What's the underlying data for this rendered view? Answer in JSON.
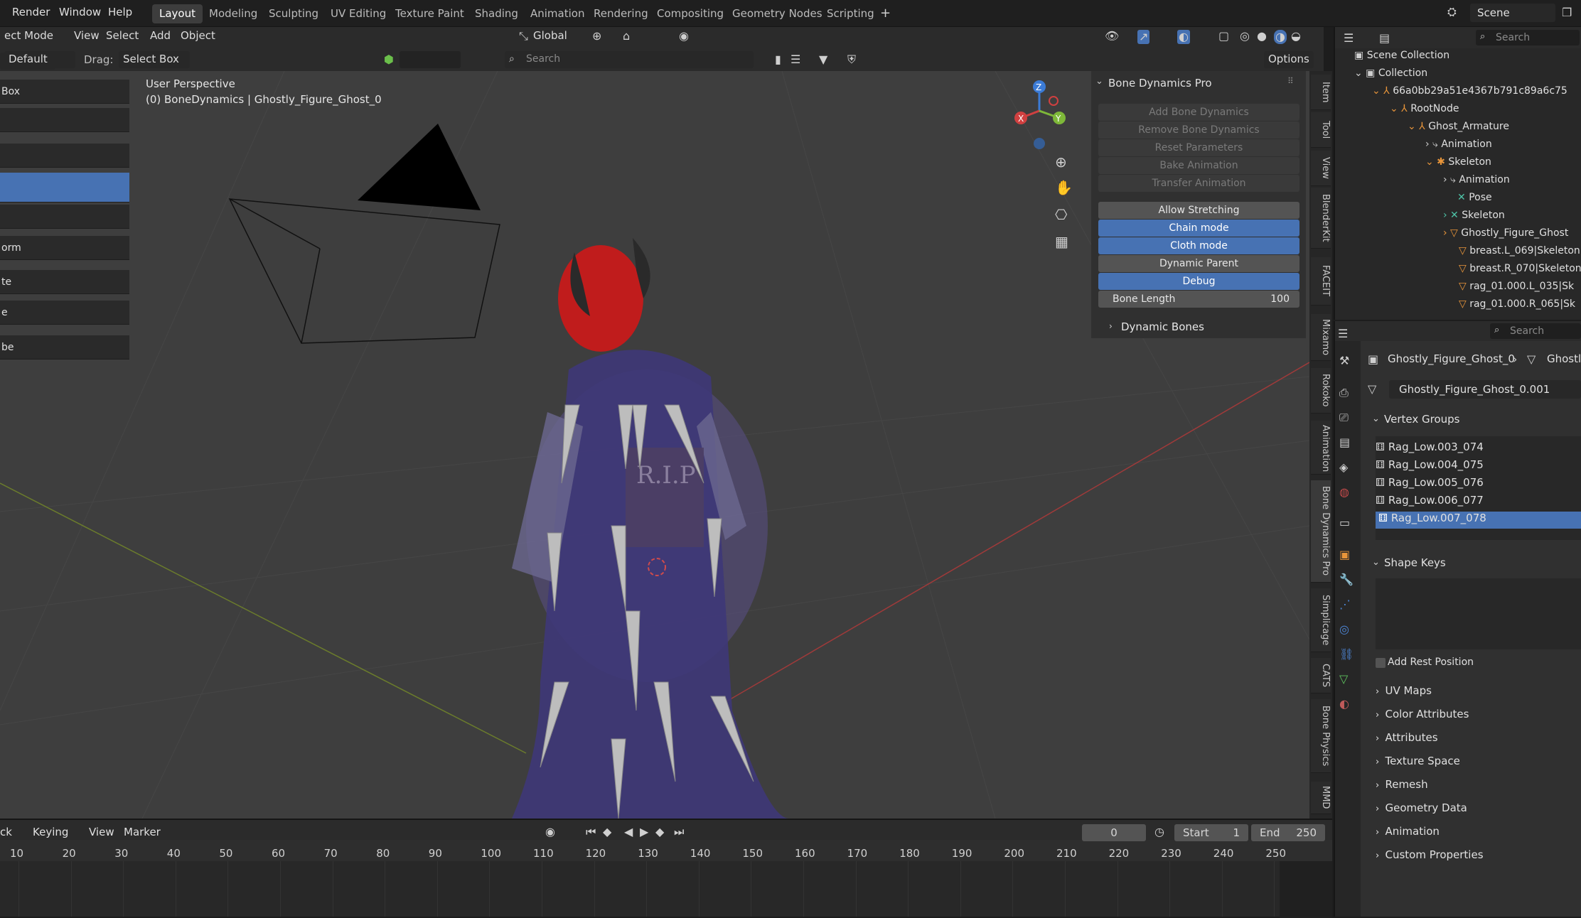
{
  "menus": [
    "Render",
    "Window",
    "Help"
  ],
  "workspaces": [
    "Layout",
    "Modeling",
    "Sculpting",
    "UV Editing",
    "Texture Paint",
    "Shading",
    "Animation",
    "Rendering",
    "Compositing",
    "Geometry Nodes",
    "Scripting"
  ],
  "scene_name": "Scene",
  "header": {
    "mode": "ect Mode",
    "view": "View",
    "select": "Select",
    "add": "Add",
    "object": "Object",
    "transform": "Global",
    "options": "Options"
  },
  "toolbar": {
    "orientation": "Default",
    "drag_label": "Drag:",
    "drag_value": "Select Box",
    "search_placeholder": "Search"
  },
  "viewport": {
    "perspective": "User Perspective",
    "object_info": "(0) BoneDynamics | Ghostly_Figure_Ghost_0"
  },
  "left_panel": [
    "Box",
    "",
    "",
    "",
    "",
    "orm",
    "te",
    "e",
    "be"
  ],
  "npanel": {
    "title": "Bone Dynamics Pro",
    "disabled_buttons": [
      "Add Bone Dynamics",
      "Remove Bone Dynamics",
      "Reset Parameters",
      "Bake Animation",
      "Transfer Animation"
    ],
    "toggles": [
      {
        "label": "Allow Stretching",
        "on": false
      },
      {
        "label": "Chain mode",
        "on": true
      },
      {
        "label": "Cloth mode",
        "on": true
      },
      {
        "label": "Dynamic Parent",
        "on": false
      },
      {
        "label": "Debug",
        "on": true
      }
    ],
    "bone_length_label": "Bone Length",
    "bone_length_value": "100",
    "sub_panel": "Dynamic Bones"
  },
  "vertical_tabs": [
    "Item",
    "Tool",
    "View",
    "BlenderKit",
    "FACEIT",
    "Mixamo",
    "Rokoko",
    "Animation",
    "Bone Dynamics Pro",
    "Simplicage",
    "CATS",
    "Bone Physics",
    "MMD"
  ],
  "outliner": {
    "search_placeholder": "Search",
    "rows": [
      {
        "label": "Scene Collection",
        "indent": 0
      },
      {
        "label": "Collection",
        "indent": 1
      },
      {
        "label": "66a0bb29a51e4367b791c89a6c75",
        "indent": 2
      },
      {
        "label": "RootNode",
        "indent": 3
      },
      {
        "label": "Ghost_Armature",
        "indent": 4
      },
      {
        "label": "Animation",
        "indent": 5
      },
      {
        "label": "Skeleton",
        "indent": 5
      },
      {
        "label": "Animation",
        "indent": 6
      },
      {
        "label": "Pose",
        "indent": 6
      },
      {
        "label": "Skeleton",
        "indent": 6
      },
      {
        "label": "Ghostly_Figure_Ghost",
        "indent": 6
      },
      {
        "label": "breast.L_069|Skeleton",
        "indent": 6
      },
      {
        "label": "breast.R_070|Skeleton",
        "indent": 6
      },
      {
        "label": "rag_01.000.L_035|Sk",
        "indent": 6
      },
      {
        "label": "rag_01.000.R_065|Sk",
        "indent": 6
      }
    ]
  },
  "properties": {
    "search_placeholder": "Search",
    "breadcrumb_object": "Ghostly_Figure_Ghost_0",
    "breadcrumb_data": "Ghostly",
    "mesh_name": "Ghostly_Figure_Ghost_0.001",
    "vertex_groups_title": "Vertex Groups",
    "vertex_groups": [
      "Rag_Low.003_074",
      "Rag_Low.004_075",
      "Rag_Low.005_076",
      "Rag_Low.006_077",
      "Rag_Low.007_078"
    ],
    "shape_keys_title": "Shape Keys",
    "add_rest_position": "Add Rest Position",
    "panels": [
      "UV Maps",
      "Color Attributes",
      "Attributes",
      "Texture Space",
      "Remesh",
      "Geometry Data",
      "Animation",
      "Custom Properties"
    ]
  },
  "timeline": {
    "menus": [
      "ck",
      "Keying",
      "View",
      "Marker"
    ],
    "current_frame": "0",
    "start_label": "Start",
    "start_value": "1",
    "end_label": "End",
    "end_value": "250",
    "ticks": [
      "10",
      "20",
      "30",
      "40",
      "50",
      "60",
      "70",
      "80",
      "90",
      "100",
      "110",
      "120",
      "130",
      "140",
      "150",
      "160",
      "170",
      "180",
      "190",
      "200",
      "210",
      "220",
      "230",
      "240",
      "250"
    ]
  },
  "colors": {
    "accent": "#4772b3",
    "bg": "#3e3e3e",
    "panel": "#303030"
  }
}
